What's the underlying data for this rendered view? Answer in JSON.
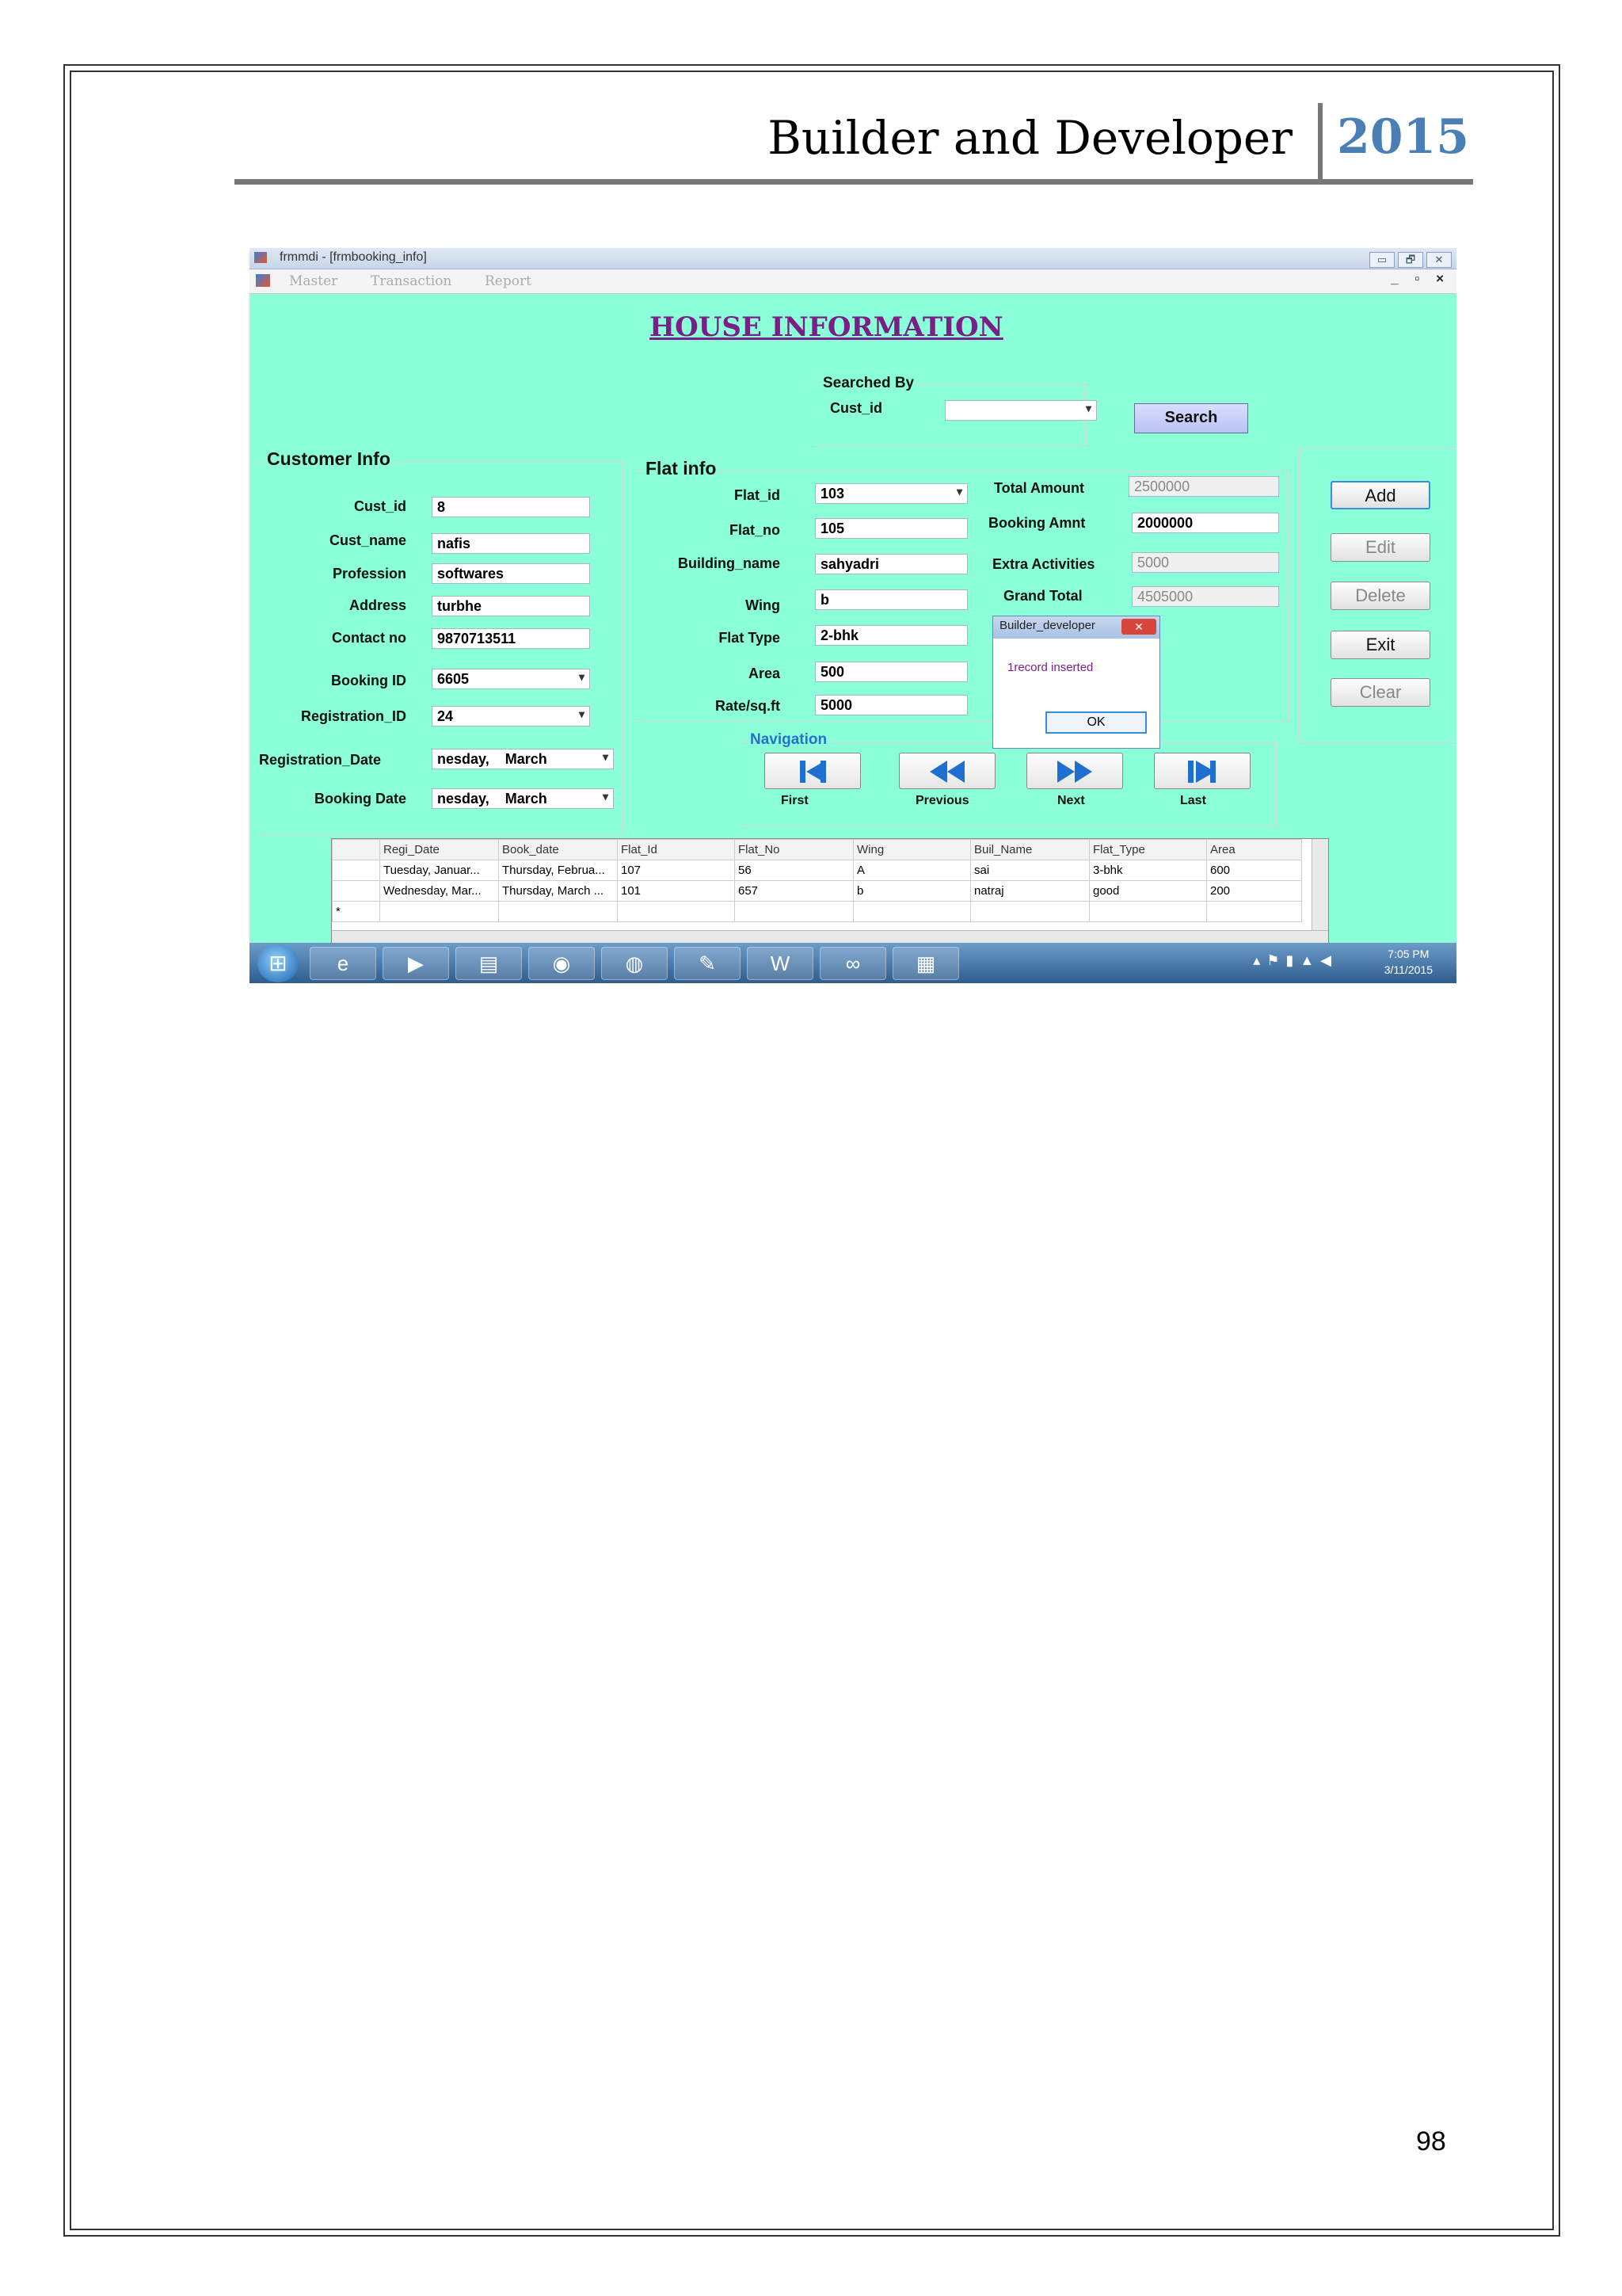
{
  "header": {
    "title": "Builder and Developer",
    "year": "2015"
  },
  "page_number": "98",
  "window": {
    "title": "frmmdi - [frmbooking_info]",
    "controls": [
      "▭",
      "🗗",
      "✕"
    ],
    "mdi_controls": "_ ▫ ×"
  },
  "menu": [
    "Master",
    "Transaction",
    "Report"
  ],
  "form_title": "HOUSE INFORMATION",
  "search": {
    "group_label": "Searched By",
    "field_label": "Cust_id",
    "value": "",
    "button": "Search"
  },
  "customer_info": {
    "label": "Customer Info",
    "fields": [
      {
        "label": "Cust_id",
        "value": "8"
      },
      {
        "label": "Cust_name",
        "value": "nafis"
      },
      {
        "label": "Profession",
        "value": "softwares"
      },
      {
        "label": "Address",
        "value": "turbhe"
      },
      {
        "label": "Contact no",
        "value": "9870713511"
      },
      {
        "label": "Booking ID",
        "value": "6605"
      },
      {
        "label": "Registration_ID",
        "value": "24"
      },
      {
        "label": "Registration_Date",
        "value": "nesday,    March"
      },
      {
        "label": "Booking Date",
        "value": "nesday,    March"
      }
    ]
  },
  "flat_info": {
    "label": "Flat info",
    "fields": [
      {
        "label": "Flat_id",
        "value": "103"
      },
      {
        "label": "Flat_no",
        "value": "105"
      },
      {
        "label": "Building_name",
        "value": "sahyadri"
      },
      {
        "label": "Wing",
        "value": "b"
      },
      {
        "label": "Flat Type",
        "value": "2-bhk"
      },
      {
        "label": "Area",
        "value": "500"
      },
      {
        "label": "Rate/sq.ft",
        "value": "5000"
      }
    ],
    "totals": [
      {
        "label": "Total Amount",
        "value": "2500000"
      },
      {
        "label": "Booking Amnt",
        "value": "2000000"
      },
      {
        "label": "Extra Activities",
        "value": "5000"
      },
      {
        "label": "Grand Total",
        "value": "4505000"
      }
    ]
  },
  "actions": [
    "Add",
    "Edit",
    "Delete",
    "Exit",
    "Clear"
  ],
  "navigation": {
    "label": "Navigation",
    "buttons": [
      "First",
      "Previous",
      "Next",
      "Last"
    ]
  },
  "dialog": {
    "title": "Builder_developer",
    "message": "1record inserted",
    "ok": "OK"
  },
  "grid": {
    "columns": [
      "Regi_Date",
      "Book_date",
      "Flat_Id",
      "Flat_No",
      "Wing",
      "Buil_Name",
      "Flat_Type",
      "Area"
    ],
    "rows": [
      [
        "Tuesday, Januar...",
        "Thursday, Februa...",
        "107",
        "56",
        "A",
        "sai",
        "3-bhk",
        "600"
      ],
      [
        "Wednesday, Mar...",
        "Thursday, March ...",
        "101",
        "657",
        "b",
        "natraj",
        "good",
        "200"
      ]
    ],
    "new_row_marker": "*"
  },
  "taskbar": {
    "time": "7:05 PM",
    "date": "3/11/2015"
  }
}
